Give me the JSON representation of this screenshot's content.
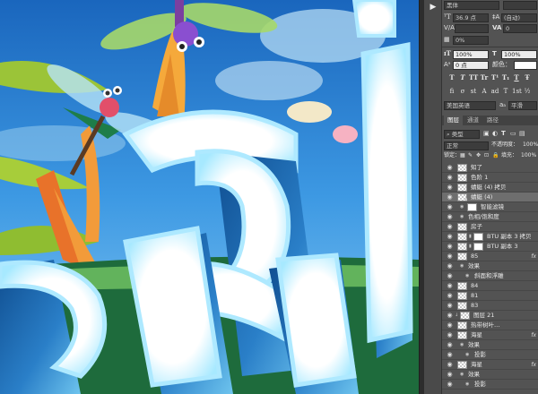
{
  "canvas": {
    "description_colors": {
      "sky": "#2c84d6",
      "letter_face": "#ffffff",
      "letter_glow": "#9ee7ff",
      "letter_depth": "#1d5fa3",
      "grass_dark": "#1e6b3c"
    }
  },
  "toolbar": {
    "play_icon": "▶"
  },
  "character": {
    "font_family": "黑体",
    "font_size": "36.9 点",
    "leading": "(自动)",
    "kerning_label": "V/A",
    "kerning_value": "0",
    "tracking_label": "VA",
    "tracking_value": "0",
    "scale_label": "0%",
    "vscale": "100%",
    "hscale": "100%",
    "baseline": "0 点",
    "color_label": "颜色：",
    "style_buttons": [
      "T",
      "T",
      "TT",
      "Tr",
      "T¹",
      "T₁",
      "T",
      "Ŧ"
    ],
    "ot_buttons": [
      "fi",
      "σ",
      "st",
      "A",
      "ad",
      "T",
      "1st",
      "½"
    ],
    "language": "美国英语",
    "aa_short": "aₐ",
    "antialias": "平滑"
  },
  "tabs": [
    {
      "label": "图层",
      "active": true
    },
    {
      "label": "通道",
      "active": false
    },
    {
      "label": "路径",
      "active": false
    }
  ],
  "layer_controls": {
    "kind": "类型",
    "blend_mode": "正常",
    "opacity_label": "不透明度：",
    "opacity_value": "100%",
    "lock_label": "锁定：",
    "fill_label": "填充：",
    "fill_value": "100%"
  },
  "layers": [
    {
      "name": "知了",
      "type": "layer"
    },
    {
      "name": "色阶 1",
      "type": "layer"
    },
    {
      "name": "蜻蜓 (4) 拷贝",
      "type": "layer"
    },
    {
      "name": "蜻蜓 (4)",
      "type": "smart",
      "selected": true
    },
    {
      "name": "智能滤镜",
      "type": "sub-mask"
    },
    {
      "name": "色相/饱和度",
      "type": "sub"
    },
    {
      "name": "房子",
      "type": "layer"
    },
    {
      "name": "BTU 副本 3 拷贝",
      "type": "masked"
    },
    {
      "name": "BTU 副本 3",
      "type": "masked"
    },
    {
      "name": "85",
      "type": "layer-fx",
      "fx": "fx"
    },
    {
      "name": "效果",
      "type": "sub"
    },
    {
      "name": "斜面和浮雕",
      "type": "sub2"
    },
    {
      "name": "84",
      "type": "layer"
    },
    {
      "name": "81",
      "type": "layer"
    },
    {
      "name": "83",
      "type": "layer"
    },
    {
      "name": "图层 21",
      "type": "clip"
    },
    {
      "name": "热带树叶…",
      "type": "layer"
    },
    {
      "name": "海星",
      "type": "layer-fx",
      "fx": "fx"
    },
    {
      "name": "效果",
      "type": "sub"
    },
    {
      "name": "投影",
      "type": "sub2"
    },
    {
      "name": "海星",
      "type": "layer-fx",
      "fx": "fx"
    },
    {
      "name": "效果",
      "type": "sub"
    },
    {
      "name": "投影",
      "type": "sub2"
    }
  ]
}
